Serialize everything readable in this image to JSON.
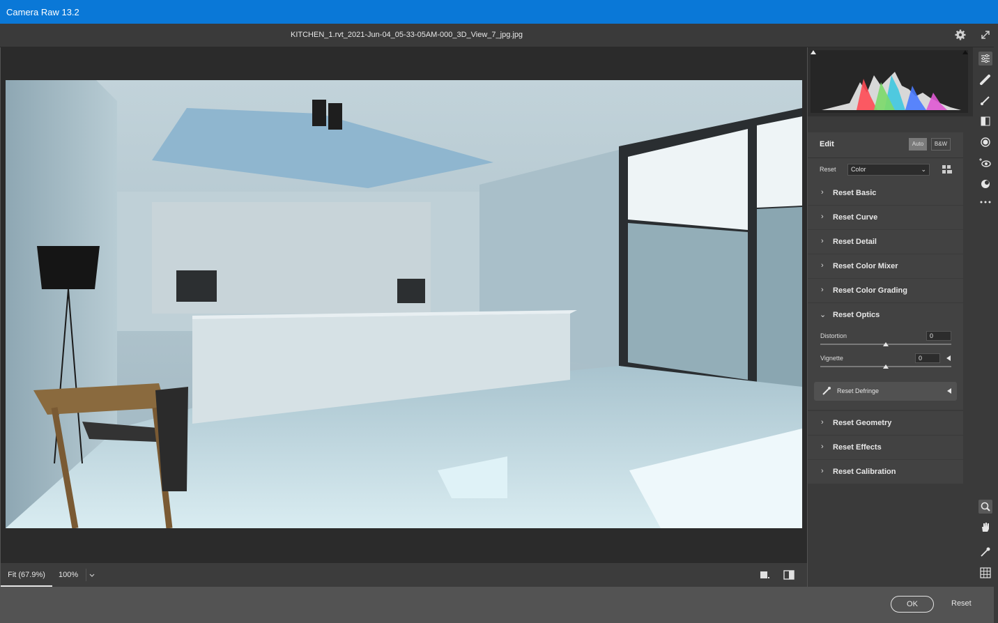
{
  "app": {
    "title": "Camera Raw 13.2"
  },
  "file": {
    "name": "KITCHEN_1.rvt_2021-Jun-04_05-33-05AM-000_3D_View_7_jpg.jpg"
  },
  "edit": {
    "heading": "Edit",
    "auto_label": "Auto",
    "bw_label": "B&W",
    "reset_label": "Reset",
    "profile_value": "Color"
  },
  "sections": [
    {
      "label": "Reset Basic"
    },
    {
      "label": "Reset Curve"
    },
    {
      "label": "Reset Detail"
    },
    {
      "label": "Reset Color Mixer"
    },
    {
      "label": "Reset Color Grading"
    }
  ],
  "optics": {
    "label": "Reset Optics",
    "distortion_label": "Distortion",
    "distortion_value": "0",
    "vignette_label": "Vignette",
    "vignette_value": "0",
    "defringe_label": "Reset Defringe"
  },
  "sections_after": [
    {
      "label": "Reset Geometry"
    },
    {
      "label": "Reset Effects"
    },
    {
      "label": "Reset Calibration"
    }
  ],
  "zoom": {
    "fit_label": "Fit (67.9%)",
    "percent_label": "100%"
  },
  "footer": {
    "ok_label": "OK",
    "reset_label": "Reset"
  },
  "tools": [
    "edit-sliders-icon",
    "healing-icon",
    "brush-icon",
    "linear-gradient-icon",
    "radial-gradient-icon",
    "red-eye-icon",
    "presets-icon",
    "more-icon",
    "zoom-icon",
    "hand-icon",
    "color-sampler-icon",
    "grid-icon"
  ],
  "colors": {
    "titlebar": "#0a78d7",
    "panel": "#424242",
    "canvas": "#2b2b2b"
  }
}
